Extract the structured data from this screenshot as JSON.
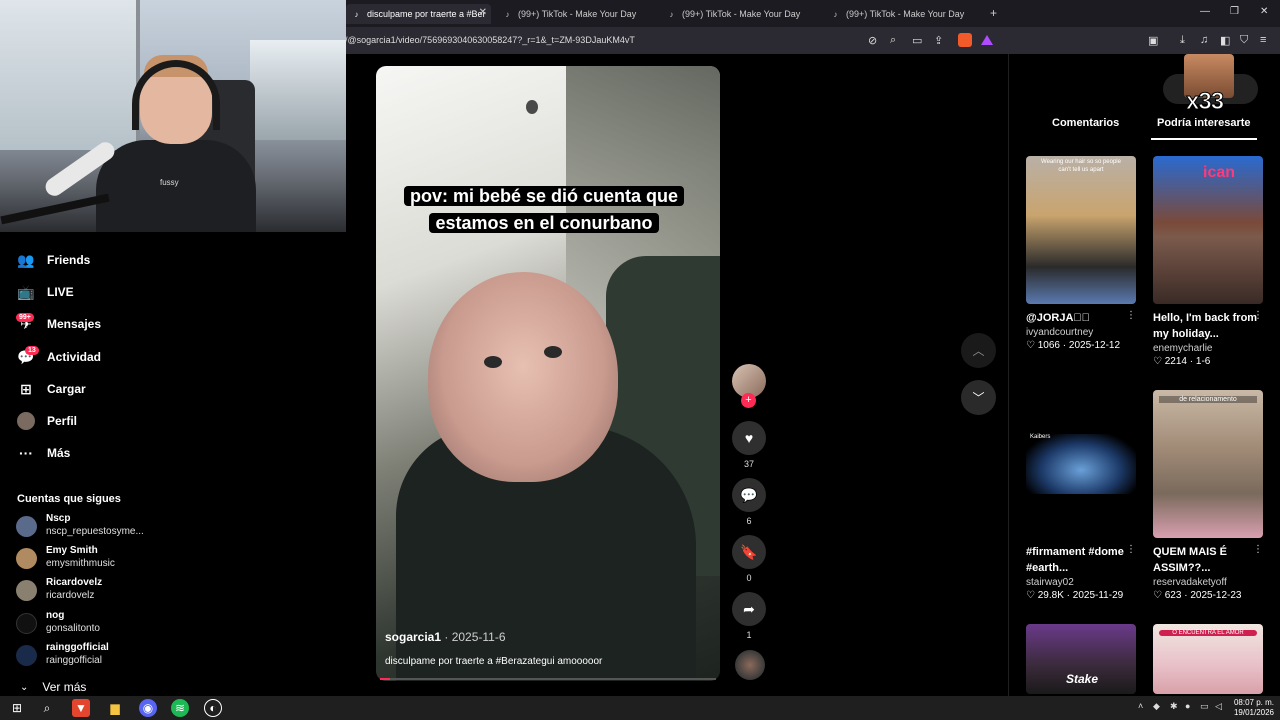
{
  "tabs": [
    {
      "label": "disculpame por traerte a #Ber"
    },
    {
      "label": "(99+) TikTok - Make Your Day"
    },
    {
      "label": "(99+) TikTok - Make Your Day"
    },
    {
      "label": "(99+) TikTok - Make Your Day"
    }
  ],
  "url": "/@sogarcia1/video/7569693040630058247?_r=1&_t=ZM-93DJauKM4vT",
  "sidebar": {
    "items": [
      {
        "label": "Friends",
        "icon": "friends-icon"
      },
      {
        "label": "LIVE",
        "icon": "live-icon"
      },
      {
        "label": "Mensajes",
        "icon": "messages-icon",
        "badge": "99+"
      },
      {
        "label": "Actividad",
        "icon": "activity-icon",
        "badge": "13"
      },
      {
        "label": "Cargar",
        "icon": "upload-icon"
      },
      {
        "label": "Perfil",
        "icon": "profile-icon"
      },
      {
        "label": "Más",
        "icon": "more-icon"
      }
    ],
    "following_title": "Cuentas que sigues",
    "accounts": [
      {
        "name": "Nscp",
        "handle": "nscp_repuestosyme..."
      },
      {
        "name": "Emy Smith",
        "handle": "emysmithmusic"
      },
      {
        "name": "Ricardovelz",
        "handle": "ricardovelz"
      },
      {
        "name": "nog",
        "handle": "gonsalitonto"
      },
      {
        "name": "rainggofficial",
        "handle": "rainggofficial"
      }
    ],
    "see_more": "Ver más"
  },
  "video": {
    "caption_line1": "pov: mi bebé se dió cuenta que",
    "caption_line2": "estamos en el conurbano",
    "author": "sogarcia1",
    "date": " · 2025-11-6",
    "description": "disculpame por traerte a #Berazategui amooooor",
    "progress": 0.03
  },
  "actions": {
    "likes": "37",
    "comments": "6",
    "saves": "0",
    "shares": "1"
  },
  "right_panel": {
    "tab_comments": "Comentarios",
    "tab_suggested": "Podría interesarte",
    "overlay_text": "x33",
    "cards": [
      {
        "title": "@JORJA\u0000\u0000",
        "author": "ivyandcourtney",
        "likes": "1066",
        "date": "2025-12-12",
        "thumb_text": "Wearing our hair so so people can't tell us apart"
      },
      {
        "title": "Hello, I'm back from my holiday...",
        "author": "enemycharlie",
        "likes": "2214",
        "date": "1-6",
        "thumb_text": "ican"
      },
      {
        "title": "#firmament #dome #earth...",
        "author": "stairway02",
        "likes": "29.8K",
        "date": "2025-11-29",
        "thumb_text": "Kaibers"
      },
      {
        "title": "QUEM MAIS É ASSIM??...",
        "author": "reservadaketyoff",
        "likes": "623",
        "date": "2025-12-23",
        "thumb_text": "de relacionamento"
      },
      {
        "title": "",
        "author": "",
        "likes": "",
        "date": "",
        "thumb_text": "Stake"
      },
      {
        "title": "",
        "author": "",
        "likes": "",
        "date": "",
        "thumb_text": "O ENCUENTRA EL AMOR"
      }
    ]
  },
  "webcam": {
    "brand": "fussy"
  },
  "taskbar": {
    "time": "08:07 p. m.",
    "date": "19/01/2026"
  },
  "colors": {
    "accent": "#fe2c55",
    "background": "#000000"
  }
}
